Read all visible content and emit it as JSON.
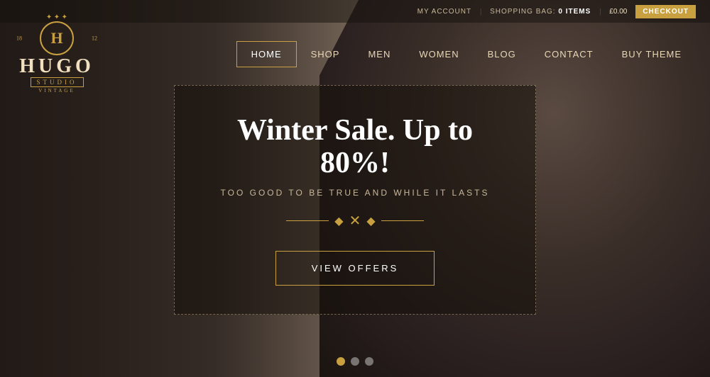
{
  "brand": {
    "name": "HUGO",
    "subtitle": "STUDIO",
    "tagline": "VINTAGE",
    "year_left": "18",
    "year_right": "12"
  },
  "topbar": {
    "my_account_label": "MY ACCOUNT",
    "shopping_bag_label": "SHOPPING BAG:",
    "items_count": "0 ITEMS",
    "price": "£0.00",
    "checkout_label": "CHECKOUT"
  },
  "nav": {
    "items": [
      {
        "label": "HOME",
        "active": true
      },
      {
        "label": "SHOP",
        "active": false
      },
      {
        "label": "MEN",
        "active": false
      },
      {
        "label": "WOMEN",
        "active": false
      },
      {
        "label": "BLOG",
        "active": false
      },
      {
        "label": "CONTACT",
        "active": false
      },
      {
        "label": "BUY THEME",
        "active": false
      }
    ]
  },
  "hero": {
    "title": "Winter Sale. Up to 80%!",
    "subtitle": "TOO GOOD TO BE TRUE AND WHILE IT LASTS",
    "cta_label": "VIEW OFFERS"
  },
  "slides": {
    "total": 3,
    "active": 0
  }
}
